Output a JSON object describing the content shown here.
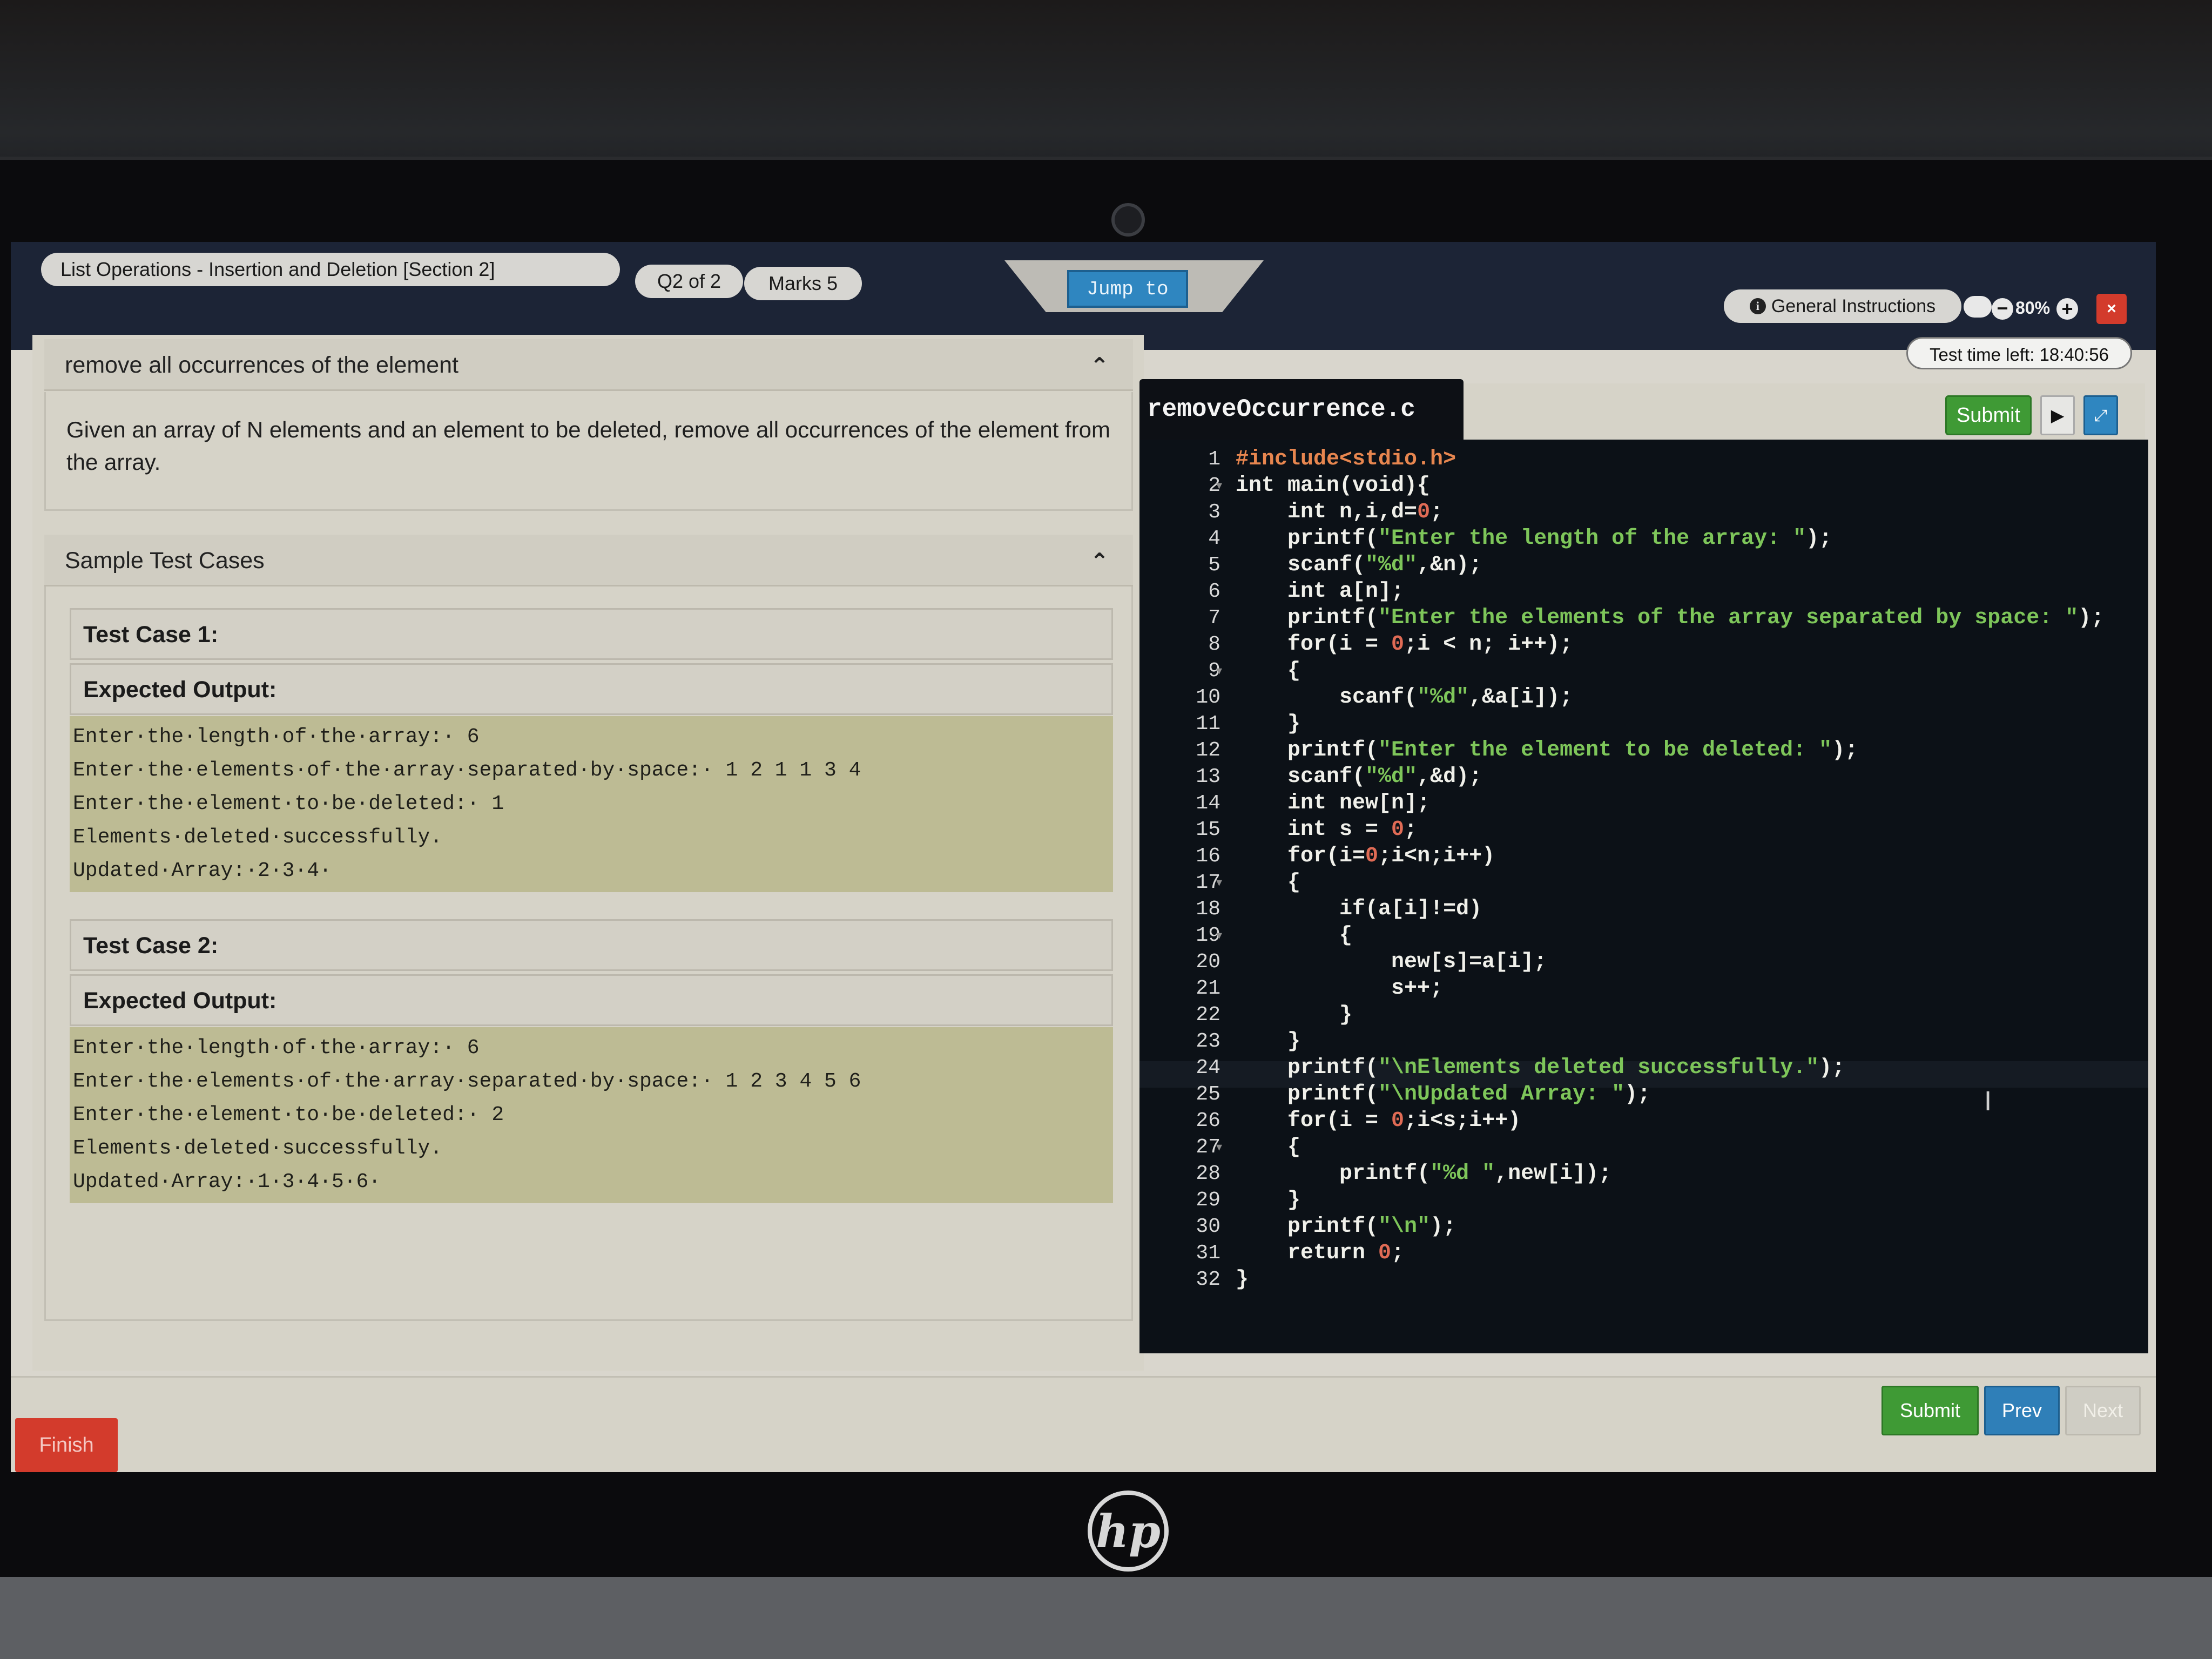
{
  "header": {
    "section_title": "List Operations - Insertion and Deletion [Section 2]",
    "question_counter": "Q2 of 2",
    "marks": "Marks 5",
    "jump_label": "Jump to",
    "general_instructions": "General Instructions",
    "zoom_level": "80%",
    "zoom_out_icon": "−",
    "zoom_in_icon": "+",
    "close_icon": "×",
    "timer": "Test time left: 18:40:56"
  },
  "problem": {
    "title": "remove all occurrences of the element",
    "description": "Given an array of N elements and an element to be deleted, remove all occurrences of the element from the array."
  },
  "samples": {
    "section_title": "Sample Test Cases",
    "test_cases": [
      {
        "name": "Test Case 1:",
        "expected_label": "Expected Output:",
        "lines": [
          "Enter·the·length·of·the·array:· 6",
          "Enter·the·elements·of·the·array·separated·by·space:· 1 2 1 1 3 4",
          "Enter·the·element·to·be·deleted:· 1",
          "Elements·deleted·successfully.",
          "Updated·Array:·2·3·4·"
        ]
      },
      {
        "name": "Test Case 2:",
        "expected_label": "Expected Output:",
        "lines": [
          "Enter·the·length·of·the·array:· 6",
          "Enter·the·elements·of·the·array·separated·by·space:· 1 2 3 4 5 6",
          "Enter·the·element·to·be·deleted:· 2",
          "Elements·deleted·successfully.",
          "Updated·Array:·1·3·4·5·6·"
        ]
      }
    ]
  },
  "editor": {
    "filename": "removeOccurrence.c",
    "submit_label": "Submit",
    "play_icon": "▶",
    "expand_icon": "⤢",
    "lines": [
      "#include<stdio.h>",
      "int main(void){",
      "    int n,i,d=0;",
      "    printf(\"Enter the length of the array: \");",
      "    scanf(\"%d\",&n);",
      "    int a[n];",
      "    printf(\"Enter the elements of the array separated by space: \");",
      "    for(i = 0;i < n; i++);",
      "    {",
      "        scanf(\"%d\",&a[i]);",
      "    }",
      "    printf(\"Enter the element to be deleted: \");",
      "    scanf(\"%d\",&d);",
      "    int new[n];",
      "    int s = 0;",
      "    for(i=0;i<n;i++)",
      "    {",
      "        if(a[i]!=d)",
      "        {",
      "            new[s]=a[i];",
      "            s++;",
      "        }",
      "    }",
      "    printf(\"\\nElements deleted successfully.\");",
      "    printf(\"\\nUpdated Array: \");",
      "    for(i = 0;i<s;i++)",
      "    {",
      "        printf(\"%d \",new[i]);",
      "    }",
      "    printf(\"\\n\");",
      "    return 0;",
      "}"
    ],
    "fold_lines": [
      2,
      9,
      17,
      19,
      27
    ]
  },
  "footer": {
    "finish_label": "Finish",
    "submit_label": "Submit",
    "prev_label": "Prev",
    "next_label": "Next"
  },
  "device": {
    "brand_logo": "hp"
  },
  "colors": {
    "topbar": "#1c2436",
    "editor_bg": "#0c1117",
    "string": "#7ec65a",
    "number": "#e06b55",
    "submit_green": "#3f9a35",
    "primary_blue": "#2f7fb8",
    "danger_red": "#d33b2c"
  }
}
